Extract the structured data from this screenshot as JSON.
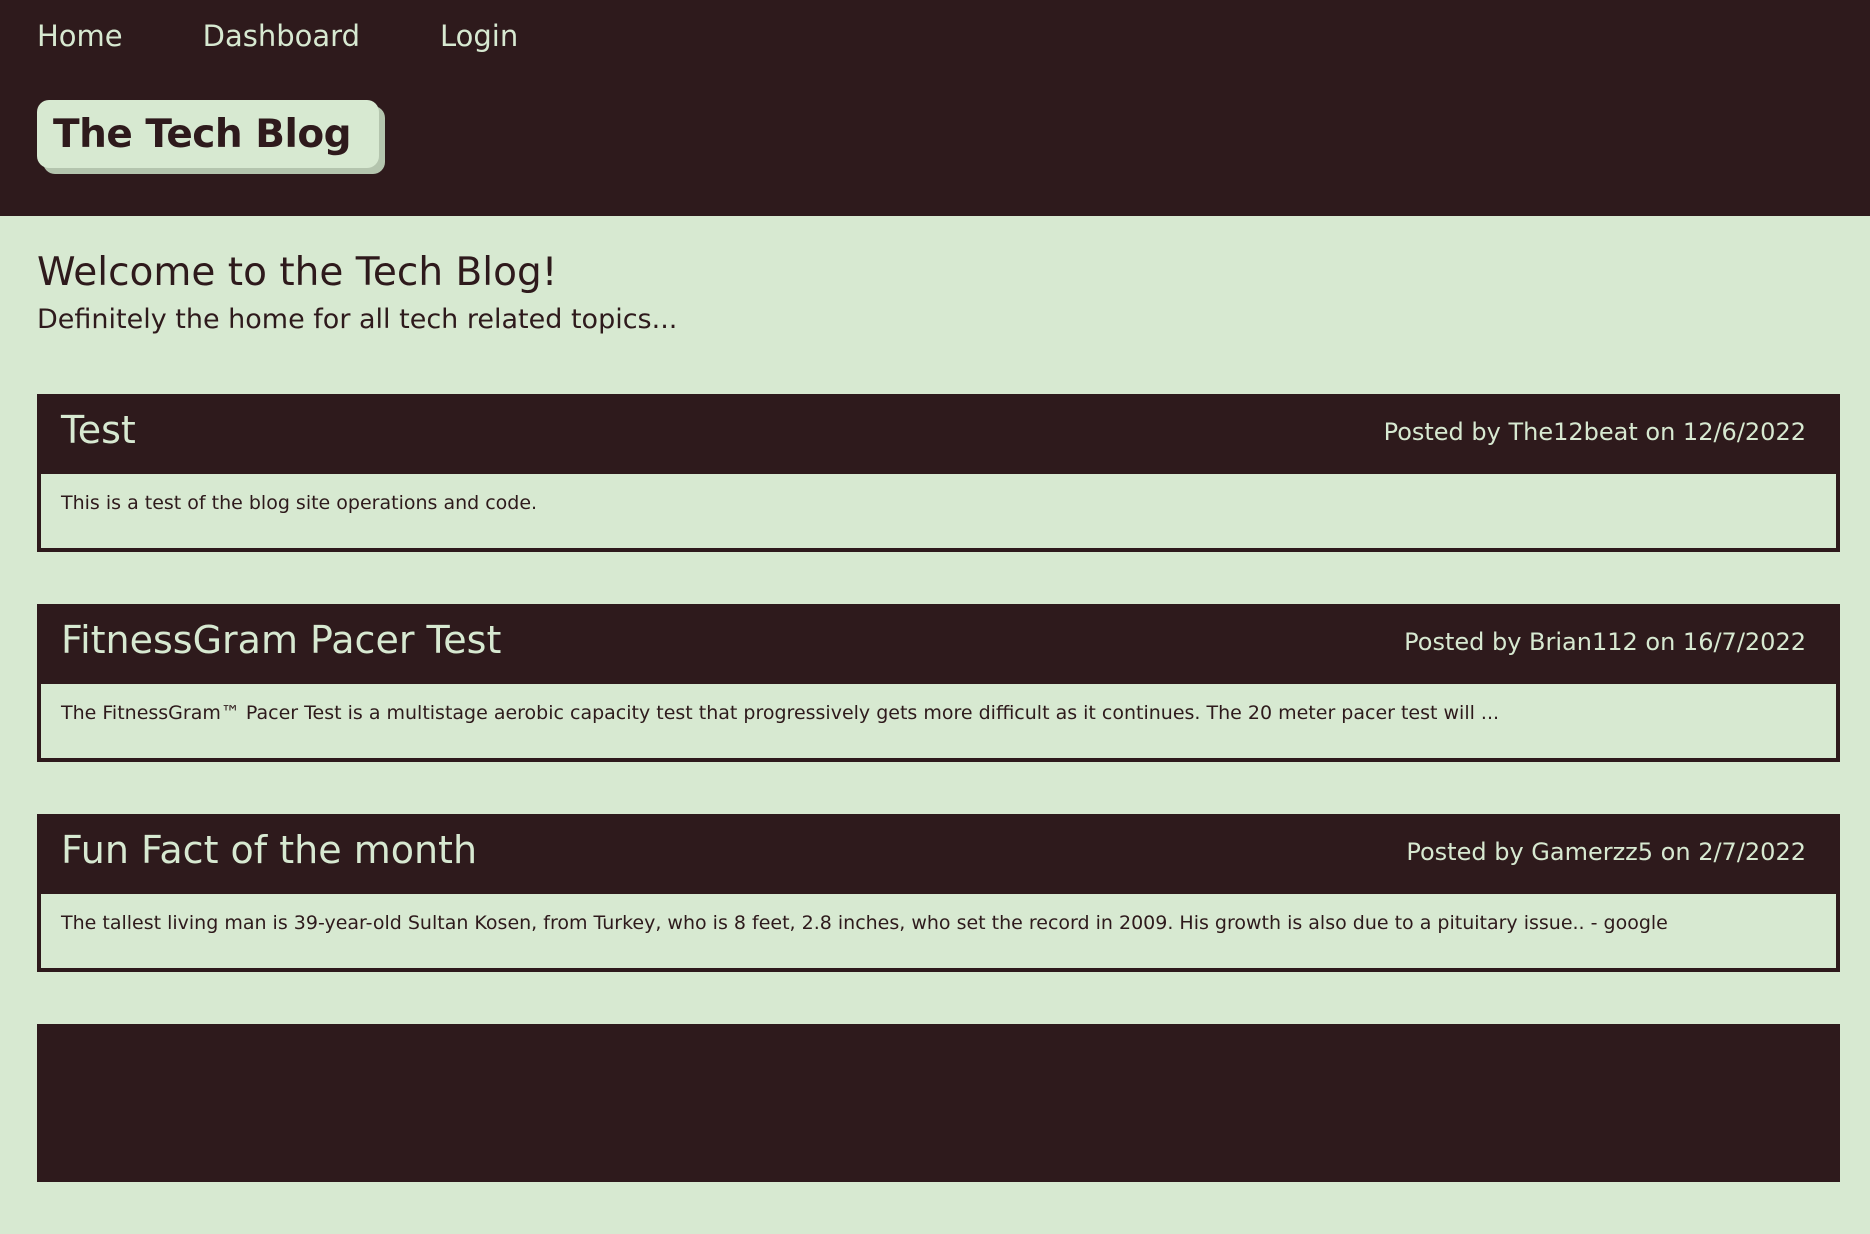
{
  "nav": {
    "links": [
      {
        "label": "Home"
      },
      {
        "label": "Dashboard"
      },
      {
        "label": "Login"
      }
    ]
  },
  "brand": {
    "title": "The Tech Blog"
  },
  "welcome": {
    "title": "Welcome to the Tech Blog!",
    "subtitle": "Definitely the home for all tech related topics..."
  },
  "posts": [
    {
      "title": "Test",
      "meta": "Posted by The12beat on 12/6/2022",
      "body": "This is a test of the blog site operations and code."
    },
    {
      "title": "FitnessGram Pacer Test",
      "meta": "Posted by Brian112 on 16/7/2022",
      "body": "The FitnessGram™ Pacer Test is a multistage aerobic capacity test that progressively gets more difficult as it continues. The 20 meter pacer test will ..."
    },
    {
      "title": "Fun Fact of the month",
      "meta": "Posted by Gamerzz5 on 2/7/2022",
      "body": "The tallest living man is 39-year-old Sultan Kosen, from Turkey, who is 8 feet, 2.8 inches, who set the record in 2009. His growth is also due to a pituitary issue.. - google"
    },
    {
      "title": "",
      "meta": "",
      "body": ""
    }
  ],
  "colors": {
    "dark": "#2e1a1c",
    "light": "#d7e9d1",
    "brand_shadow": "#b4c5ae"
  }
}
